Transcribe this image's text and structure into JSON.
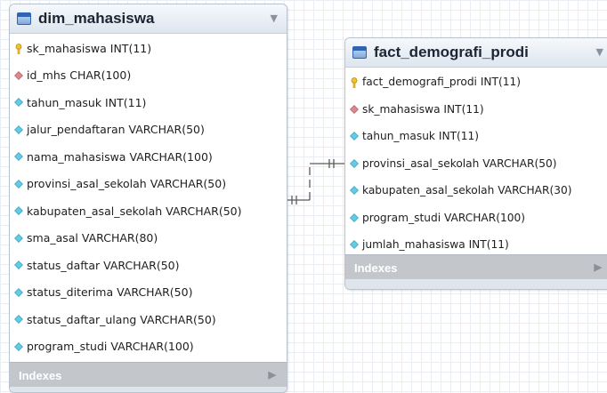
{
  "colors": {
    "primary_key": "#f2c230",
    "foreign_key": "#d98a8f",
    "column": "#64cbe4",
    "indexes_bar": "#c3c7cc",
    "relationship_line": "#5a5a5a"
  },
  "tables": [
    {
      "name": "dim_mahasiswa",
      "columns": [
        {
          "icon": "key-icon",
          "text": "sk_mahasiswa INT(11)"
        },
        {
          "icon": "diamond-red-icon",
          "text": "id_mhs CHAR(100)"
        },
        {
          "icon": "diamond-blue-icon",
          "text": "tahun_masuk INT(11)"
        },
        {
          "icon": "diamond-blue-icon",
          "text": "jalur_pendaftaran VARCHAR(50)"
        },
        {
          "icon": "diamond-blue-icon",
          "text": "nama_mahasiswa VARCHAR(100)"
        },
        {
          "icon": "diamond-blue-icon",
          "text": "provinsi_asal_sekolah VARCHAR(50)"
        },
        {
          "icon": "diamond-blue-icon",
          "text": "kabupaten_asal_sekolah VARCHAR(50)"
        },
        {
          "icon": "diamond-blue-icon",
          "text": "sma_asal VARCHAR(80)"
        },
        {
          "icon": "diamond-blue-icon",
          "text": "status_daftar VARCHAR(50)"
        },
        {
          "icon": "diamond-blue-icon",
          "text": "status_diterima VARCHAR(50)"
        },
        {
          "icon": "diamond-blue-icon",
          "text": "status_daftar_ulang VARCHAR(50)"
        },
        {
          "icon": "diamond-blue-icon",
          "text": "program_studi VARCHAR(100)"
        }
      ],
      "indexes_label": "Indexes"
    },
    {
      "name": "fact_demografi_prodi",
      "columns": [
        {
          "icon": "key-icon",
          "text": "fact_demografi_prodi INT(11)"
        },
        {
          "icon": "diamond-red-icon",
          "text": "sk_mahasiswa INT(11)"
        },
        {
          "icon": "diamond-blue-icon",
          "text": "tahun_masuk INT(11)"
        },
        {
          "icon": "diamond-blue-icon",
          "text": "provinsi_asal_sekolah VARCHAR(50)"
        },
        {
          "icon": "diamond-blue-icon",
          "text": "kabupaten_asal_sekolah VARCHAR(30)"
        },
        {
          "icon": "diamond-blue-icon",
          "text": "program_studi VARCHAR(100)"
        },
        {
          "icon": "diamond-blue-icon",
          "text": "jumlah_mahasiswa INT(11)"
        }
      ],
      "indexes_label": "Indexes"
    }
  ]
}
